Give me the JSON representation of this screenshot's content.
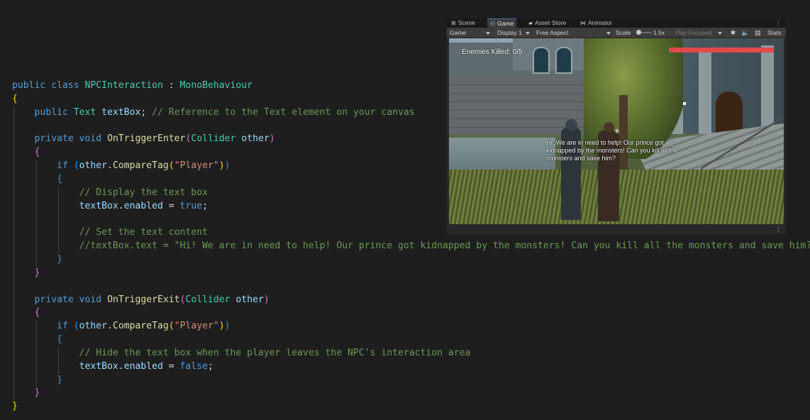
{
  "editor": {
    "lines": [
      [
        [
          "kw",
          "public"
        ],
        [
          "t",
          " "
        ],
        [
          "kw",
          "class"
        ],
        [
          "t",
          " "
        ],
        [
          "ty",
          "NPCInteraction"
        ],
        [
          "t",
          " : "
        ],
        [
          "ty",
          "MonoBehaviour"
        ]
      ],
      [
        [
          "b1",
          "{"
        ]
      ],
      [
        [
          "t",
          "    "
        ],
        [
          "kw",
          "public"
        ],
        [
          "t",
          " "
        ],
        [
          "ty",
          "Text"
        ],
        [
          "t",
          " "
        ],
        [
          "vr",
          "textBox"
        ],
        [
          "t",
          "; "
        ],
        [
          "cm",
          "// Reference to the Text element on your canvas"
        ]
      ],
      [],
      [
        [
          "t",
          "    "
        ],
        [
          "kw",
          "private"
        ],
        [
          "t",
          " "
        ],
        [
          "kw",
          "void"
        ],
        [
          "t",
          " "
        ],
        [
          "fn",
          "OnTriggerEnter"
        ],
        [
          "b2",
          "("
        ],
        [
          "ty",
          "Collider"
        ],
        [
          "t",
          " "
        ],
        [
          "vr",
          "other"
        ],
        [
          "b2",
          ")"
        ]
      ],
      [
        [
          "t",
          "    "
        ],
        [
          "b2",
          "{"
        ]
      ],
      [
        [
          "t",
          "        "
        ],
        [
          "kw",
          "if"
        ],
        [
          "t",
          " "
        ],
        [
          "b3",
          "("
        ],
        [
          "vr",
          "other"
        ],
        [
          "t",
          "."
        ],
        [
          "fn",
          "CompareTag"
        ],
        [
          "b1",
          "("
        ],
        [
          "st",
          "\"Player\""
        ],
        [
          "b1",
          ")"
        ],
        [
          "b3",
          ")"
        ]
      ],
      [
        [
          "t",
          "        "
        ],
        [
          "b3",
          "{"
        ]
      ],
      [
        [
          "t",
          "            "
        ],
        [
          "cm",
          "// Display the text box"
        ]
      ],
      [
        [
          "t",
          "            "
        ],
        [
          "vr",
          "textBox"
        ],
        [
          "t",
          "."
        ],
        [
          "vr",
          "enabled"
        ],
        [
          "t",
          " = "
        ],
        [
          "kw",
          "true"
        ],
        [
          "t",
          ";"
        ]
      ],
      [],
      [
        [
          "t",
          "            "
        ],
        [
          "cm",
          "// Set the text content"
        ]
      ],
      [
        [
          "t",
          "            "
        ],
        [
          "cm",
          "//textBox.text = \"Hi! We are in need to help! Our prince got kidnapped by the monsters! Can you kill all the monsters and save him?\";"
        ]
      ],
      [
        [
          "t",
          "        "
        ],
        [
          "b3",
          "}"
        ]
      ],
      [
        [
          "t",
          "    "
        ],
        [
          "b2",
          "}"
        ]
      ],
      [],
      [
        [
          "t",
          "    "
        ],
        [
          "kw",
          "private"
        ],
        [
          "t",
          " "
        ],
        [
          "kw",
          "void"
        ],
        [
          "t",
          " "
        ],
        [
          "fn",
          "OnTriggerExit"
        ],
        [
          "b2",
          "("
        ],
        [
          "ty",
          "Collider"
        ],
        [
          "t",
          " "
        ],
        [
          "vr",
          "other"
        ],
        [
          "b2",
          ")"
        ]
      ],
      [
        [
          "t",
          "    "
        ],
        [
          "b2",
          "{"
        ]
      ],
      [
        [
          "t",
          "        "
        ],
        [
          "kw",
          "if"
        ],
        [
          "t",
          " "
        ],
        [
          "b3",
          "("
        ],
        [
          "vr",
          "other"
        ],
        [
          "t",
          "."
        ],
        [
          "fn",
          "CompareTag"
        ],
        [
          "b1",
          "("
        ],
        [
          "st",
          "\"Player\""
        ],
        [
          "b1",
          ")"
        ],
        [
          "b3",
          ")"
        ]
      ],
      [
        [
          "t",
          "        "
        ],
        [
          "b3",
          "{"
        ]
      ],
      [
        [
          "t",
          "            "
        ],
        [
          "cm",
          "// Hide the text box when the player leaves the NPC's interaction area"
        ]
      ],
      [
        [
          "t",
          "            "
        ],
        [
          "vr",
          "textBox"
        ],
        [
          "t",
          "."
        ],
        [
          "vr",
          "enabled"
        ],
        [
          "t",
          " = "
        ],
        [
          "kw",
          "false"
        ],
        [
          "t",
          ";"
        ]
      ],
      [
        [
          "t",
          "        "
        ],
        [
          "b3",
          "}"
        ]
      ],
      [
        [
          "t",
          "    "
        ],
        [
          "b2",
          "}"
        ]
      ],
      [
        [
          "b1",
          "}"
        ]
      ]
    ]
  },
  "unity": {
    "tabs": [
      {
        "label": "Scene",
        "icon": "grid-icon",
        "glyph": "⊞"
      },
      {
        "label": "Game",
        "icon": "gamepad-icon",
        "glyph": "⚇"
      },
      {
        "label": "Asset Store",
        "icon": "store-bag-icon",
        "glyph": "▰"
      },
      {
        "label": "Animator",
        "icon": "animator-icon",
        "glyph": "⋈"
      }
    ],
    "menu_glyph": "⋮",
    "toolbar": {
      "mode": "Game",
      "display": "Display 1",
      "aspect": "Free Aspect",
      "scale_label": "Scale",
      "scale_value": "1.5x",
      "play_focused": "Play Focused",
      "stats": "Stats",
      "bug_glyph": "✱",
      "audio_glyph": "🔈",
      "gizmo_glyph": "▤"
    },
    "game": {
      "enemies_killed": "Enemies Killed: 0/5",
      "health_fraction": 1.0,
      "health_color": "#e24a4a",
      "dialog": "Hi! We are in need to help! Our prince got kidnapped by the monsters! Can you kill all the monsters and save him?",
      "crosshair_glyph": "⁜"
    }
  }
}
